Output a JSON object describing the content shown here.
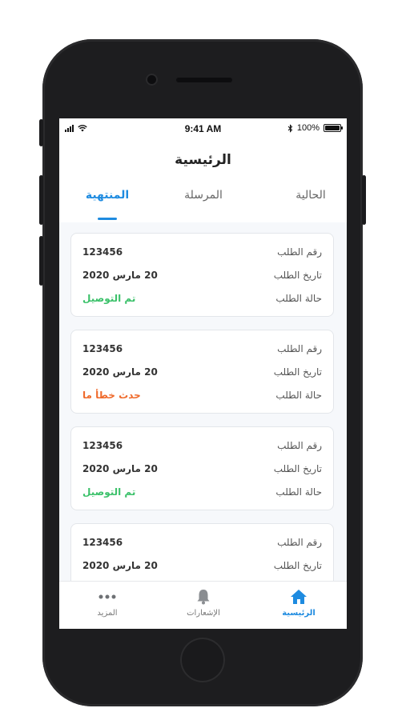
{
  "status_bar": {
    "time": "9:41 AM",
    "battery": "100%",
    "battery_level": 1.0,
    "icons": [
      "signal-icon",
      "wifi-icon",
      "bluetooth-icon",
      "battery-icon"
    ]
  },
  "header": {
    "title": "الرئيسية"
  },
  "tabs": [
    {
      "label": "الحالية",
      "active": false
    },
    {
      "label": "المرسلة",
      "active": false
    },
    {
      "label": "المنتهية",
      "active": true
    }
  ],
  "orders": [
    {
      "order_number_label": "رقم الطلب",
      "order_number": "123456",
      "date_label": "تاريخ الطلب",
      "date": "20 مارس 2020",
      "status_label": "حالة الطلب",
      "status": "تم التوصيل",
      "status_color": "#3bc16a"
    },
    {
      "order_number_label": "رقم الطلب",
      "order_number": "123456",
      "date_label": "تاريخ الطلب",
      "date": "20 مارس 2020",
      "status_label": "حالة الطلب",
      "status": "حدث خطأ ما",
      "status_color": "#ef6a2b"
    },
    {
      "order_number_label": "رقم الطلب",
      "order_number": "123456",
      "date_label": "تاريخ الطلب",
      "date": "20 مارس 2020",
      "status_label": "حالة الطلب",
      "status": "تم التوصيل",
      "status_color": "#3bc16a"
    },
    {
      "order_number_label": "رقم الطلب",
      "order_number": "123456",
      "date_label": "تاريخ الطلب",
      "date": "20 مارس 2020",
      "status_label": "",
      "status": "",
      "status_color": "#3bc16a"
    }
  ],
  "tabbar": {
    "home": {
      "label": "الرئيسية",
      "icon": "home-icon",
      "active": true
    },
    "notifications": {
      "label": "الإشعارات",
      "icon": "bell-icon",
      "active": false
    },
    "more": {
      "label": "المزيد",
      "icon": "more-dots-icon",
      "active": false
    }
  },
  "colors": {
    "accent": "#1e8be0",
    "success": "#3bc16a",
    "error": "#ef6a2b"
  }
}
